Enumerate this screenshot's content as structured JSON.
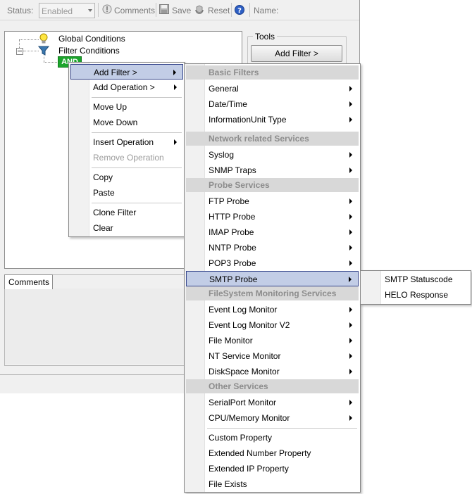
{
  "toolbar": {
    "status_label": "Status:",
    "status_value": "Enabled",
    "comments_label": "Comments",
    "save_label": "Save",
    "reset_label": "Reset",
    "name_label": "Name:"
  },
  "tree": {
    "global_conditions": "Global Conditions",
    "filter_conditions": "Filter Conditions",
    "and_node": "AND"
  },
  "tools": {
    "legend": "Tools",
    "add_filter_button": "Add Filter >"
  },
  "comments_tab": "Comments",
  "context_menu": {
    "add_filter": "Add Filter >",
    "add_operation": "Add Operation >",
    "move_up": "Move Up",
    "move_down": "Move Down",
    "insert_operation": "Insert Operation",
    "remove_operation": "Remove Operation",
    "copy": "Copy",
    "paste": "Paste",
    "clone_filter": "Clone Filter",
    "clear": "Clear"
  },
  "filter_menu": {
    "basic_filters": "Basic Filters",
    "general": "General",
    "date_time": "Date/Time",
    "information_unit_type": "InformationUnit Type",
    "network_services": "Network related Services",
    "syslog": "Syslog",
    "snmp_traps": "SNMP Traps",
    "probe_services": "Probe Services",
    "ftp_probe": "FTP Probe",
    "http_probe": "HTTP Probe",
    "imap_probe": "IMAP Probe",
    "nntp_probe": "NNTP Probe",
    "pop3_probe": "POP3 Probe",
    "smtp_probe": "SMTP Probe",
    "filesystem_services": "FileSystem Monitoring Services",
    "event_log_monitor": "Event Log Monitor",
    "event_log_monitor_v2": "Event Log Monitor V2",
    "file_monitor": "File Monitor",
    "nt_service_monitor": "NT Service Monitor",
    "diskspace_monitor": "DiskSpace Monitor",
    "other_services": "Other Services",
    "serialport_monitor": "SerialPort Monitor",
    "cpu_memory_monitor": "CPU/Memory Monitor",
    "custom_property": "Custom Property",
    "extended_number_property": "Extended Number Property",
    "extended_ip_property": "Extended IP Property",
    "file_exists": "File Exists"
  },
  "smtp_menu": {
    "statuscode": "SMTP Statuscode",
    "helo_response": "HELO Response"
  },
  "icons": {
    "comments": "comment-icon",
    "save": "floppy-disk-icon",
    "reset": "reset-icon",
    "help": "help-icon",
    "global": "lightbulb-icon",
    "filter": "funnel-icon"
  }
}
